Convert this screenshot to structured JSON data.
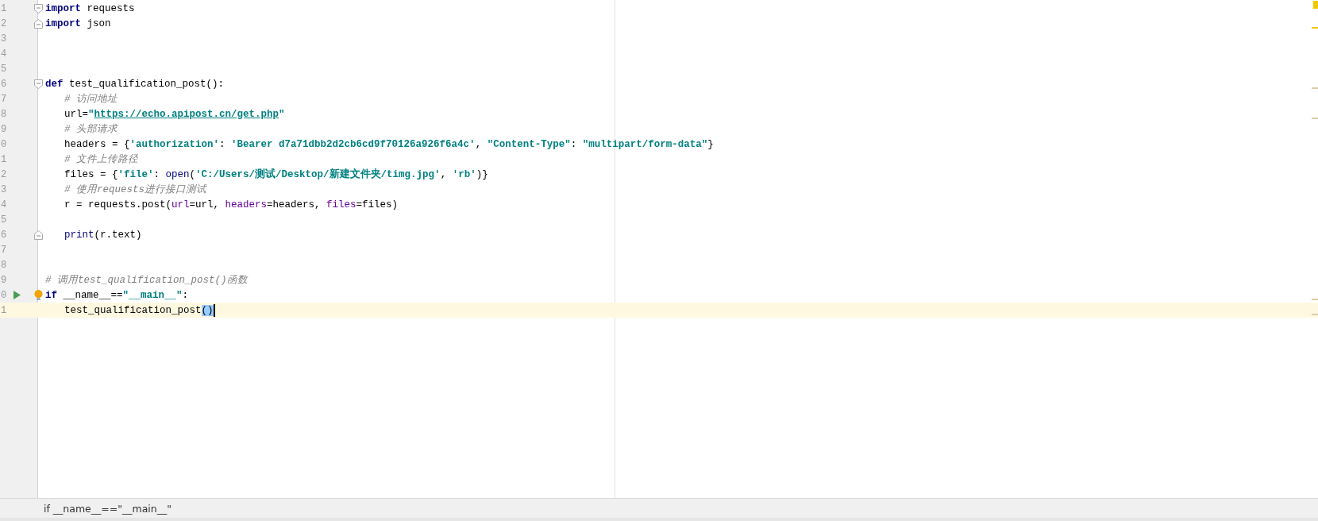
{
  "editor": {
    "lines": [
      {
        "number": "1",
        "fold_start": true,
        "tokens": [
          {
            "kind": "kw",
            "text": "import"
          },
          {
            "kind": "plain",
            "text": " requests"
          }
        ]
      },
      {
        "number": "2",
        "fold_end": true,
        "tokens": [
          {
            "kind": "kw",
            "text": "import"
          },
          {
            "kind": "plain",
            "text": " json"
          }
        ]
      },
      {
        "number": "3"
      },
      {
        "number": "4"
      },
      {
        "number": "5"
      },
      {
        "number": "6",
        "fold_start": true,
        "tokens": [
          {
            "kind": "kw",
            "text": "def"
          },
          {
            "kind": "plain",
            "text": " test_qualification_post():"
          }
        ]
      },
      {
        "number": "7",
        "indented": true,
        "tokens": [
          {
            "kind": "comment",
            "text": "# 访问地址"
          }
        ]
      },
      {
        "number": "8",
        "indented": true,
        "tokens": [
          {
            "kind": "plain",
            "text": "url="
          },
          {
            "kind": "str",
            "text": "\""
          },
          {
            "kind": "link",
            "text": "https://echo.apipost.cn/get.php"
          },
          {
            "kind": "str",
            "text": "\""
          }
        ]
      },
      {
        "number": "9",
        "indented": true,
        "tokens": [
          {
            "kind": "comment",
            "text": "# 头部请求"
          }
        ]
      },
      {
        "number": "0",
        "indented": true,
        "tokens": [
          {
            "kind": "plain",
            "text": "headers = {"
          },
          {
            "kind": "str",
            "text": "'authorization'"
          },
          {
            "kind": "plain",
            "text": ": "
          },
          {
            "kind": "str",
            "text": "'Bearer d7a71dbb2d2cb6cd9f70126a926f6a4c'"
          },
          {
            "kind": "plain",
            "text": ", "
          },
          {
            "kind": "str",
            "text": "\"Content-Type\""
          },
          {
            "kind": "plain",
            "text": ": "
          },
          {
            "kind": "str",
            "text": "\"multipart/form-data\""
          },
          {
            "kind": "plain",
            "text": "}"
          }
        ]
      },
      {
        "number": "1",
        "indented": true,
        "tokens": [
          {
            "kind": "comment",
            "text": "# 文件上传路径"
          }
        ]
      },
      {
        "number": "2",
        "indented": true,
        "tokens": [
          {
            "kind": "plain",
            "text": "files = {"
          },
          {
            "kind": "str",
            "text": "'file'"
          },
          {
            "kind": "plain",
            "text": ": "
          },
          {
            "kind": "builtin",
            "text": "open"
          },
          {
            "kind": "plain",
            "text": "("
          },
          {
            "kind": "str",
            "text": "'C:/Users/测试/Desktop/新建文件夹/timg.jpg'"
          },
          {
            "kind": "plain",
            "text": ", "
          },
          {
            "kind": "str",
            "text": "'rb'"
          },
          {
            "kind": "plain",
            "text": ")}"
          }
        ]
      },
      {
        "number": "3",
        "indented": true,
        "tokens": [
          {
            "kind": "comment",
            "text": "# 使用requests进行接口测试"
          }
        ]
      },
      {
        "number": "4",
        "indented": true,
        "tokens": [
          {
            "kind": "plain",
            "text": "r = requests.post("
          },
          {
            "kind": "param",
            "text": "url"
          },
          {
            "kind": "plain",
            "text": "=url, "
          },
          {
            "kind": "param",
            "text": "headers"
          },
          {
            "kind": "plain",
            "text": "=headers, "
          },
          {
            "kind": "param",
            "text": "files"
          },
          {
            "kind": "plain",
            "text": "=files)"
          }
        ]
      },
      {
        "number": "5"
      },
      {
        "number": "6",
        "fold_end": true,
        "indented": true,
        "tokens": [
          {
            "kind": "builtin",
            "text": "print"
          },
          {
            "kind": "plain",
            "text": "(r.text)"
          }
        ]
      },
      {
        "number": "7"
      },
      {
        "number": "8"
      },
      {
        "number": "9",
        "tokens": [
          {
            "kind": "comment",
            "text": "# 调用test_qualification_post()函数"
          }
        ]
      },
      {
        "number": "0",
        "run": true,
        "bulb": true,
        "tokens": [
          {
            "kind": "kw",
            "text": "if"
          },
          {
            "kind": "plain",
            "text": " __name__=="
          },
          {
            "kind": "str",
            "text": "\"__main__\""
          },
          {
            "kind": "plain",
            "text": ":"
          }
        ]
      },
      {
        "number": "1",
        "current": true,
        "indented": true,
        "tokens": [
          {
            "kind": "plain",
            "text": "test_qualification_post"
          },
          {
            "kind": "match",
            "text": "()"
          }
        ]
      }
    ]
  },
  "status_bar": {
    "breadcrumb": "if __name__==\"__main__\""
  }
}
